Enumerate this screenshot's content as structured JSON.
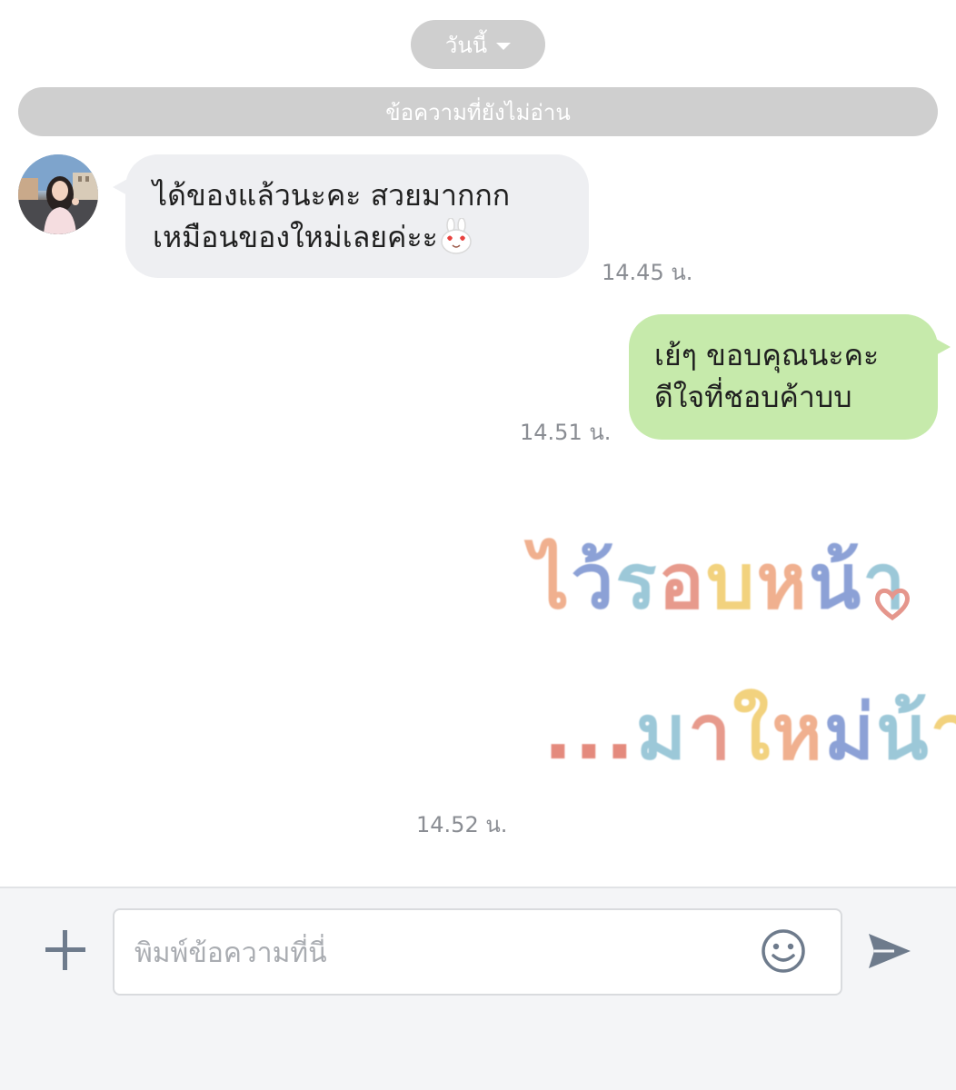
{
  "header": {
    "date_label": "วันนี้",
    "unread_label": "ข้อความที่ยังไม่อ่าน"
  },
  "messages": [
    {
      "direction": "incoming",
      "lines": [
        "ได้ของแล้วนะคะ สวยมากกก",
        "เหมือนของใหม่เลยค่ะะ"
      ],
      "time": "14.45 น."
    },
    {
      "direction": "outgoing",
      "lines": [
        "เย้ๆ ขอบคุณนะคะ",
        "ดีใจที่ชอบค้าบบ"
      ],
      "time": "14.51 น."
    },
    {
      "direction": "outgoing",
      "type": "sticker",
      "sticker_text": [
        "ไว้รอบหน้า",
        "...มาใหม่น้า"
      ],
      "time": "14.52 น."
    }
  ],
  "composer": {
    "placeholder": "พิมพ์ข้อความที่นี่",
    "icons": {
      "attach": "plus-icon",
      "emoji": "smiley-icon",
      "send": "send-icon"
    }
  },
  "colors": {
    "incoming_bubble": "#eeeff2",
    "outgoing_bubble": "#c6eaab",
    "pill": "#cfcfcf",
    "time_text": "#8a8d93",
    "icon": "#6e7b8c"
  }
}
